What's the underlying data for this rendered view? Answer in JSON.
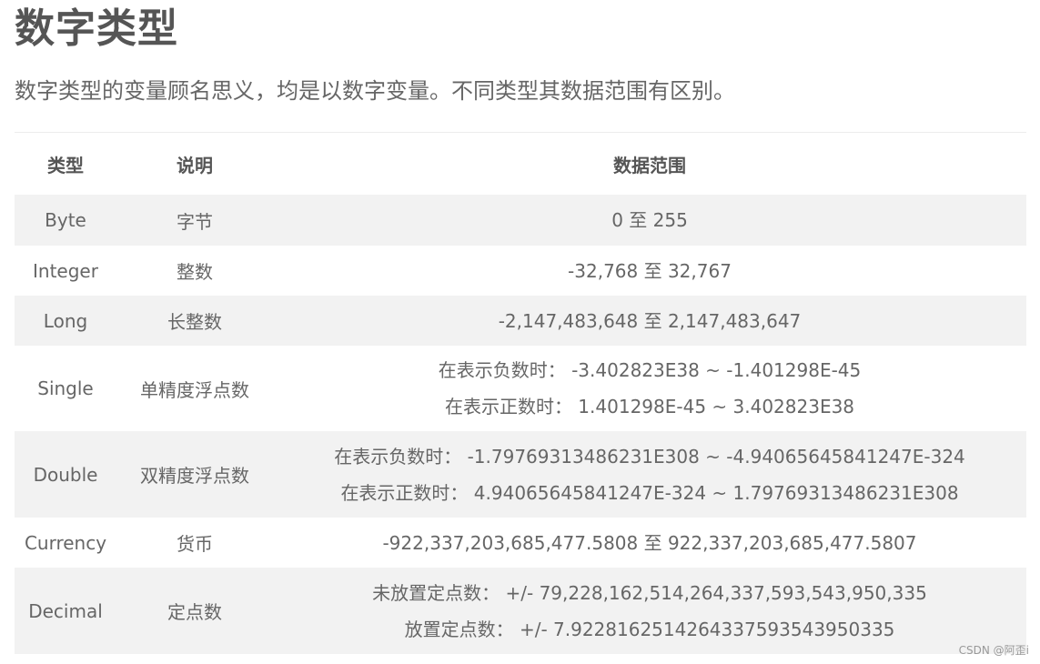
{
  "page": {
    "title": "数字类型",
    "intro": "数字类型的变量顾名思义，均是以数字变量。不同类型其数据范围有区别。"
  },
  "table": {
    "headers": {
      "type": "类型",
      "desc": "说明",
      "range": "数据范围"
    },
    "rows": [
      {
        "type": "Byte",
        "desc": "字节",
        "range": [
          "0 至 255"
        ]
      },
      {
        "type": "Integer",
        "desc": "整数",
        "range": [
          "-32,768 至 32,767"
        ]
      },
      {
        "type": "Long",
        "desc": "长整数",
        "range": [
          "-2,147,483,648 至 2,147,483,647"
        ]
      },
      {
        "type": "Single",
        "desc": "单精度浮点数",
        "range": [
          "在表示负数时：  -3.402823E38 ~ -1.401298E-45",
          "在表示正数时：  1.401298E-45 ~ 3.402823E38"
        ]
      },
      {
        "type": "Double",
        "desc": "双精度浮点数",
        "range": [
          "在表示负数时：  -1.79769313486231E308 ~ -4.94065645841247E-324",
          "在表示正数时：  4.94065645841247E-324 ~ 1.79769313486231E308"
        ]
      },
      {
        "type": "Currency",
        "desc": "货币",
        "range": [
          "-922,337,203,685,477.5808 至 922,337,203,685,477.5807"
        ]
      },
      {
        "type": "Decimal",
        "desc": "定点数",
        "range": [
          "未放置定点数：  +/- 79,228,162,514,264,337,593,543,950,335",
          "放置定点数：  +/- 7.9228162514264337593543950335"
        ]
      }
    ]
  },
  "watermark": "CSDN @阿歪i"
}
